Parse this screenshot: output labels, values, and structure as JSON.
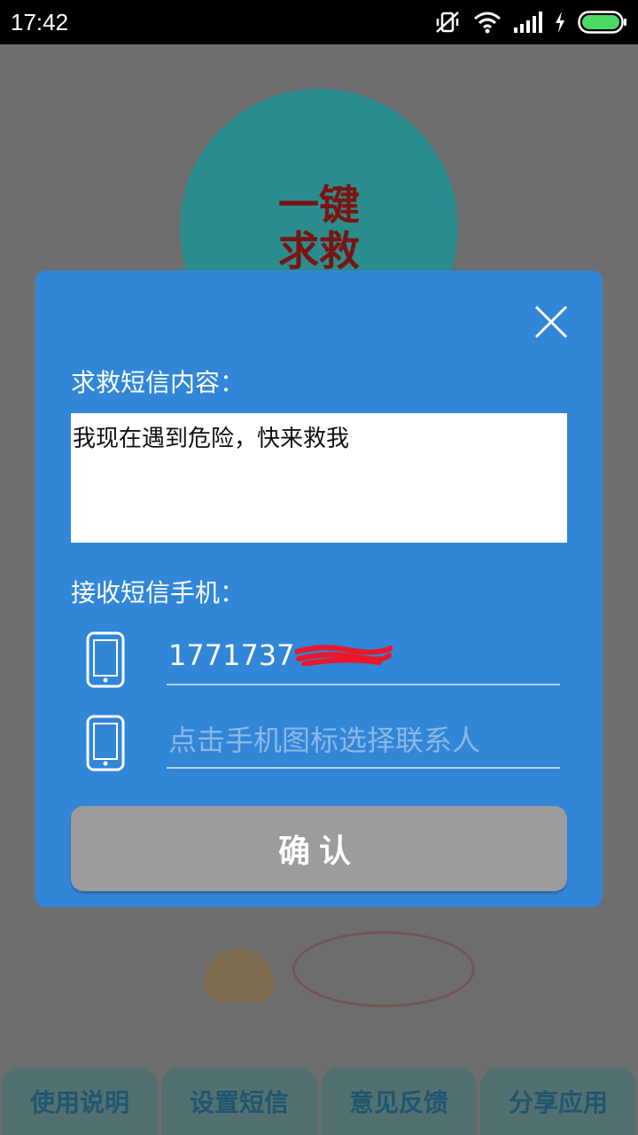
{
  "status_bar": {
    "time": "17:42",
    "icons": [
      "vibrate-off-icon",
      "wifi-icon",
      "signal-icon",
      "charging-icon",
      "battery-icon"
    ]
  },
  "app": {
    "sos_button_label": "一键\n求救",
    "bottom_nav": [
      "使用说明",
      "设置短信",
      "意见反馈",
      "分享应用"
    ]
  },
  "dialog": {
    "message_label": "求救短信内容：",
    "message_text": "我现在遇到危险，快来救我",
    "phones_label": "接收短信手机：",
    "phone1_value": "1771737",
    "phone2_placeholder": "点击手机图标选择联系人",
    "confirm_label": "确认"
  },
  "colors": {
    "dialog_bg": "#3186d8",
    "confirm_bg": "#9c9c9c",
    "sos_circle": "#2b8d8e",
    "sos_text": "#7a1414"
  }
}
